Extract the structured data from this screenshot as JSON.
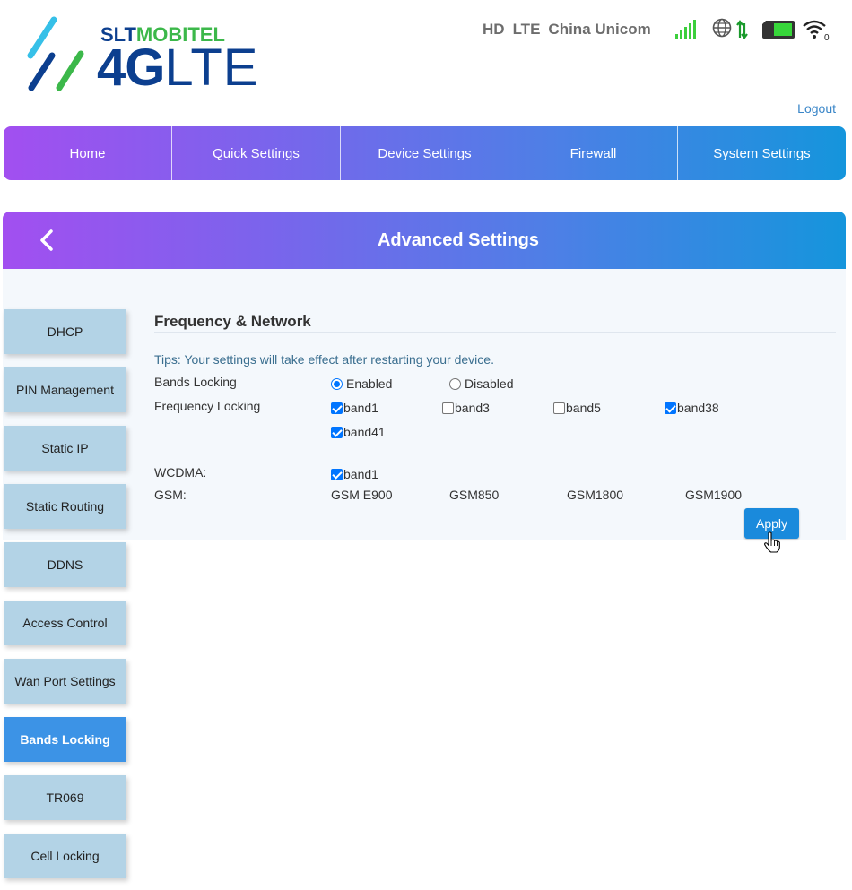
{
  "header": {
    "logo_top": "SLTMOBITEL",
    "logo_top_a": "SLT",
    "logo_top_b": "MOBITEL",
    "logo_bottom_bold": "4G",
    "logo_bottom_thin": "LTE",
    "status": {
      "hd": "HD",
      "network_type": "LTE",
      "operator": "China Unicom",
      "wifi_clients": "0"
    },
    "icons": [
      "signal-bars-icon",
      "globe-data-icon",
      "battery-icon",
      "wifi-icon"
    ],
    "logout_label": "Logout"
  },
  "nav": {
    "items": [
      {
        "label": "Home"
      },
      {
        "label": "Quick Settings"
      },
      {
        "label": "Device Settings"
      },
      {
        "label": "Firewall"
      },
      {
        "label": "System Settings"
      }
    ]
  },
  "section": {
    "title": "Advanced Settings"
  },
  "sidebar": {
    "items": [
      {
        "label": "DHCP"
      },
      {
        "label": "PIN Management"
      },
      {
        "label": "Static IP"
      },
      {
        "label": "Static Routing"
      },
      {
        "label": "DDNS"
      },
      {
        "label": "Access Control"
      },
      {
        "label": "Wan Port Settings"
      },
      {
        "label": "Bands Locking"
      },
      {
        "label": "TR069"
      },
      {
        "label": "Cell Locking"
      }
    ],
    "active": "Bands Locking"
  },
  "form": {
    "title": "Frequency & Network",
    "tips": "Tips: Your settings will take effect after restarting your device.",
    "bands_locking": {
      "label": "Bands Locking",
      "enabled_label": "Enabled",
      "disabled_label": "Disabled",
      "selected": "Enabled"
    },
    "frequency_locking": {
      "label": "Frequency Locking",
      "bands": [
        {
          "label": "band1",
          "checked": true
        },
        {
          "label": "band3",
          "checked": false
        },
        {
          "label": "band5",
          "checked": false
        },
        {
          "label": "band38",
          "checked": true
        },
        {
          "label": "band41",
          "checked": true
        }
      ]
    },
    "wcdma": {
      "label": "WCDMA:",
      "bands": [
        {
          "label": "band1",
          "checked": true
        }
      ]
    },
    "gsm": {
      "label": "GSM:",
      "options": [
        "GSM E900",
        "GSM850",
        "GSM1800",
        "GSM1900"
      ]
    },
    "apply_label": "Apply"
  },
  "colors": {
    "nav_gradient_start": "#a24ff0",
    "nav_gradient_end": "#1595dc",
    "sidebar_item": "#b3d3e6",
    "sidebar_active": "#3c93e6",
    "apply_button": "#1a8adc",
    "logo_blue": "#0c3f8f",
    "logo_green": "#3cb84a"
  }
}
